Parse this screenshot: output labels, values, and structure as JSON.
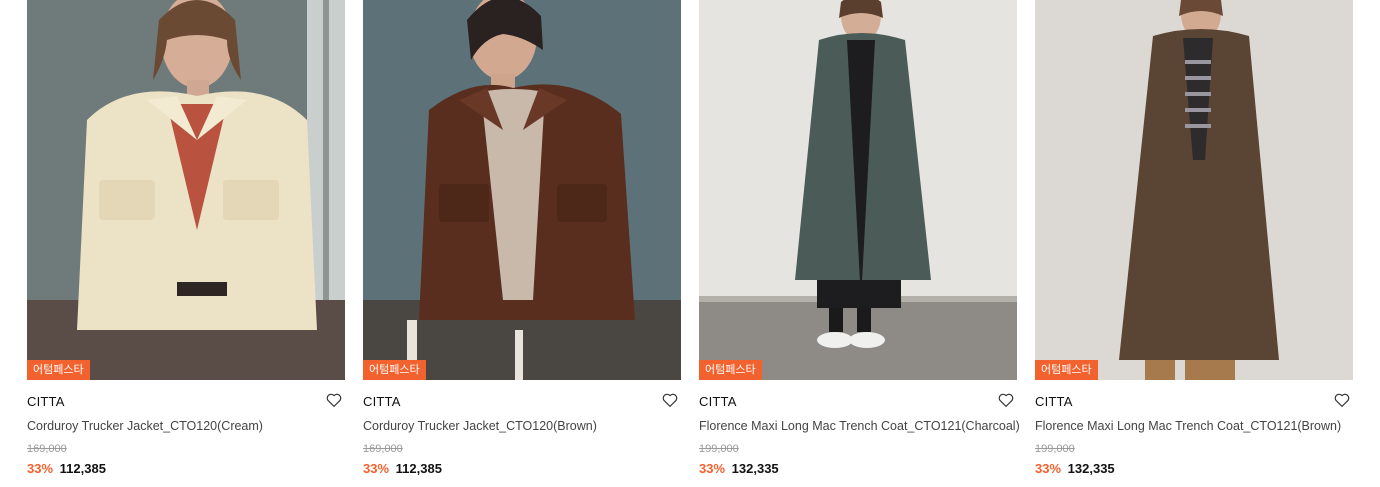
{
  "products": [
    {
      "badge": "어텀페스타",
      "brand": "CITTA",
      "name": "Corduroy Trucker Jacket_CTO120(Cream)",
      "original_price": "169,000",
      "discount": "33%",
      "sale_price": "112,385",
      "wishlist_icon": "heart-outline-icon"
    },
    {
      "badge": "어텀페스타",
      "brand": "CITTA",
      "name": "Corduroy Trucker Jacket_CTO120(Brown)",
      "original_price": "169,000",
      "discount": "33%",
      "sale_price": "112,385",
      "wishlist_icon": "heart-outline-icon"
    },
    {
      "badge": "어텀페스타",
      "brand": "CITTA",
      "name": "Florence Maxi Long Mac Trench Coat_CTO121(Charcoal)",
      "original_price": "199,000",
      "discount": "33%",
      "sale_price": "132,335",
      "wishlist_icon": "heart-outline-icon"
    },
    {
      "badge": "어텀페스타",
      "brand": "CITTA",
      "name": "Florence Maxi Long Mac Trench Coat_CTO121(Brown)",
      "original_price": "199,000",
      "discount": "33%",
      "sale_price": "132,335",
      "wishlist_icon": "heart-outline-icon"
    }
  ],
  "colors": {
    "accent": "#f2622e",
    "text": "#111111",
    "muted": "#9a9a9a"
  }
}
